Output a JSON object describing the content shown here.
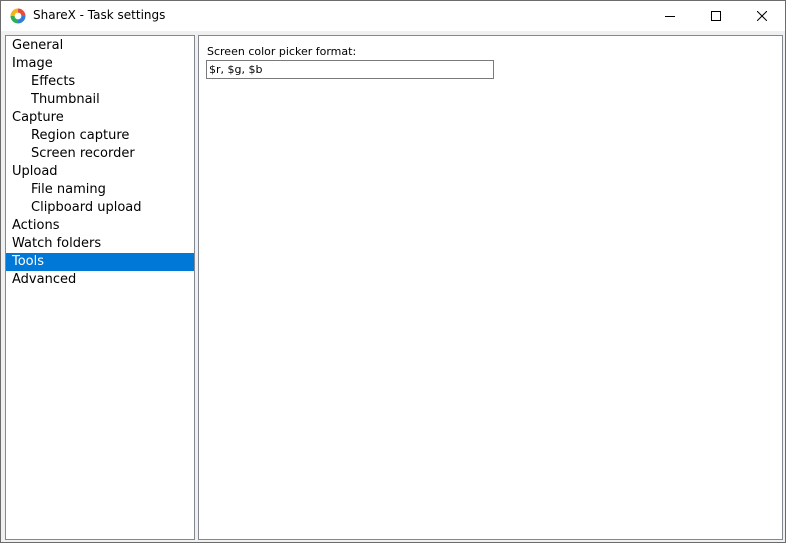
{
  "window": {
    "title": "ShareX - Task settings",
    "app_icon": "sharex-logo-icon",
    "controls": [
      {
        "name": "minimize",
        "icon": "minimize-icon"
      },
      {
        "name": "maximize",
        "icon": "maximize-icon"
      },
      {
        "name": "close",
        "icon": "close-icon"
      }
    ]
  },
  "sidebar": {
    "items": [
      {
        "label": "General",
        "level": 0,
        "selected": false
      },
      {
        "label": "Image",
        "level": 0,
        "selected": false
      },
      {
        "label": "Effects",
        "level": 1,
        "selected": false
      },
      {
        "label": "Thumbnail",
        "level": 1,
        "selected": false
      },
      {
        "label": "Capture",
        "level": 0,
        "selected": false
      },
      {
        "label": "Region capture",
        "level": 1,
        "selected": false
      },
      {
        "label": "Screen recorder",
        "level": 1,
        "selected": false
      },
      {
        "label": "Upload",
        "level": 0,
        "selected": false
      },
      {
        "label": "File naming",
        "level": 1,
        "selected": false
      },
      {
        "label": "Clipboard upload",
        "level": 1,
        "selected": false
      },
      {
        "label": "Actions",
        "level": 0,
        "selected": false
      },
      {
        "label": "Watch folders",
        "level": 0,
        "selected": false
      },
      {
        "label": "Tools",
        "level": 0,
        "selected": true
      },
      {
        "label": "Advanced",
        "level": 0,
        "selected": false
      }
    ]
  },
  "tools_panel": {
    "color_picker_label": "Screen color picker format:",
    "color_picker_value": "$r, $g, $b"
  },
  "colors": {
    "selection": "#0078d7",
    "border": "#828790",
    "window_background": "#f0f0f0"
  }
}
